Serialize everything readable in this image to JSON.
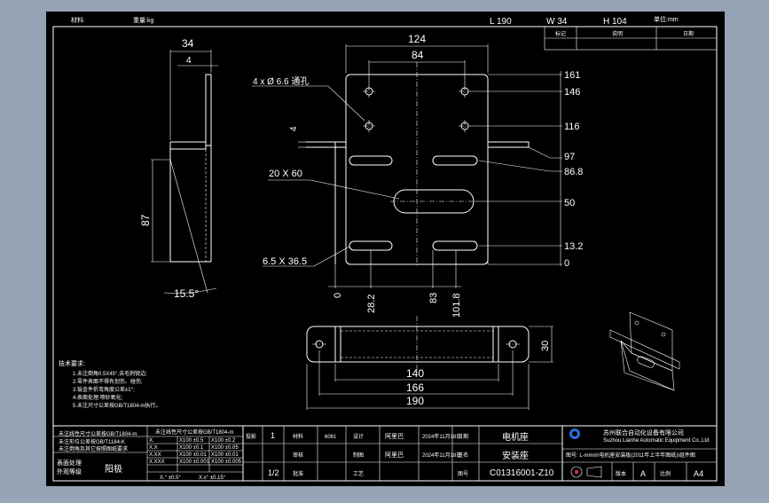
{
  "header": {
    "material_label": "材料:",
    "weight_label": "重量:kg",
    "dims": [
      "L 190",
      "W 34",
      "H 104"
    ],
    "unit_label": "单位:mm"
  },
  "revision_table": {
    "headers": [
      "标记",
      "说明",
      "日期"
    ]
  },
  "side_view": {
    "dims": [
      "34",
      "4",
      "87",
      "15.5°"
    ]
  },
  "front_view": {
    "dims_top": [
      "124",
      "84"
    ],
    "dim_left": "4",
    "labels": [
      "4 x Ø 6.6 通孔",
      "20 X 60",
      "6.5 X 36.5"
    ],
    "right_ordinates": [
      "161",
      "146",
      "116",
      "97",
      "86.8",
      "50",
      "13.2",
      "0"
    ],
    "bottom_ordinates": [
      "0",
      "28.2",
      "83",
      "101.8"
    ]
  },
  "top_view": {
    "dims": [
      "140",
      "166",
      "190",
      "30"
    ]
  },
  "notes": {
    "title": "技术要求:",
    "lines": [
      "1.未注倒角0.5X45°,去毛刺锐边;",
      "2.零件表面不得有划伤、碰伤;",
      "3.钣金件折弯角度公差±1°;",
      "4.表面处理:喷砂氧化;",
      "5.未注尺寸公差按GB/T1804-m执行。"
    ]
  },
  "title_block": {
    "tol_header": [
      "未注线性尺寸公差按GB/T1804-m",
      "未注形位公差按GB/T1184-K",
      "未注倒角及其它按照图纸要求"
    ],
    "tol_rows": [
      [
        "X.",
        "X100 ±0.5",
        "X100 ±0.2"
      ],
      [
        "X.X",
        "X100 ±0.1",
        "X100 ±0.05"
      ],
      [
        "X.XX",
        "X100 ±0.01",
        "X100 ±0.01"
      ],
      [
        "X.XXX",
        "X100 ±0.001",
        "X100 ±0.005"
      ],
      [
        "X.°  ±0.5°",
        "X.x°  ±0.15°",
        ""
      ]
    ],
    "surface_labels": [
      "表面处理",
      "外观等级"
    ],
    "proj_label": "投影",
    "finish_label": "阳极",
    "qty_1": "1",
    "qty_12": "1/2",
    "design_label": "设计",
    "check_label": "审核",
    "process_label": "工艺",
    "approve_label": "批准",
    "date_label": "日期",
    "sign_label": "签名",
    "material_row": [
      "材料",
      "6061",
      "设计",
      "阿里巴",
      "2024年11月18日"
    ],
    "check_row": [
      "审核",
      "制图",
      "阿里巴",
      "2024年11月18日"
    ],
    "part_name": "电机座",
    "part_name2": "安装座",
    "company": "苏州联合自动化设备有限公司",
    "company_en": "Suzhou Lianhe Automatic Equipment Co.,Ltd",
    "file_path": "图号: L-mmm\\电机座安装板(2011年上半年图纸)\\组件图",
    "drawing_no_label": "图号",
    "drawing_no": "C01316001-Z10",
    "version_label": "版本",
    "version": "A",
    "scale_label": "比例",
    "sheet_size": "A4"
  }
}
